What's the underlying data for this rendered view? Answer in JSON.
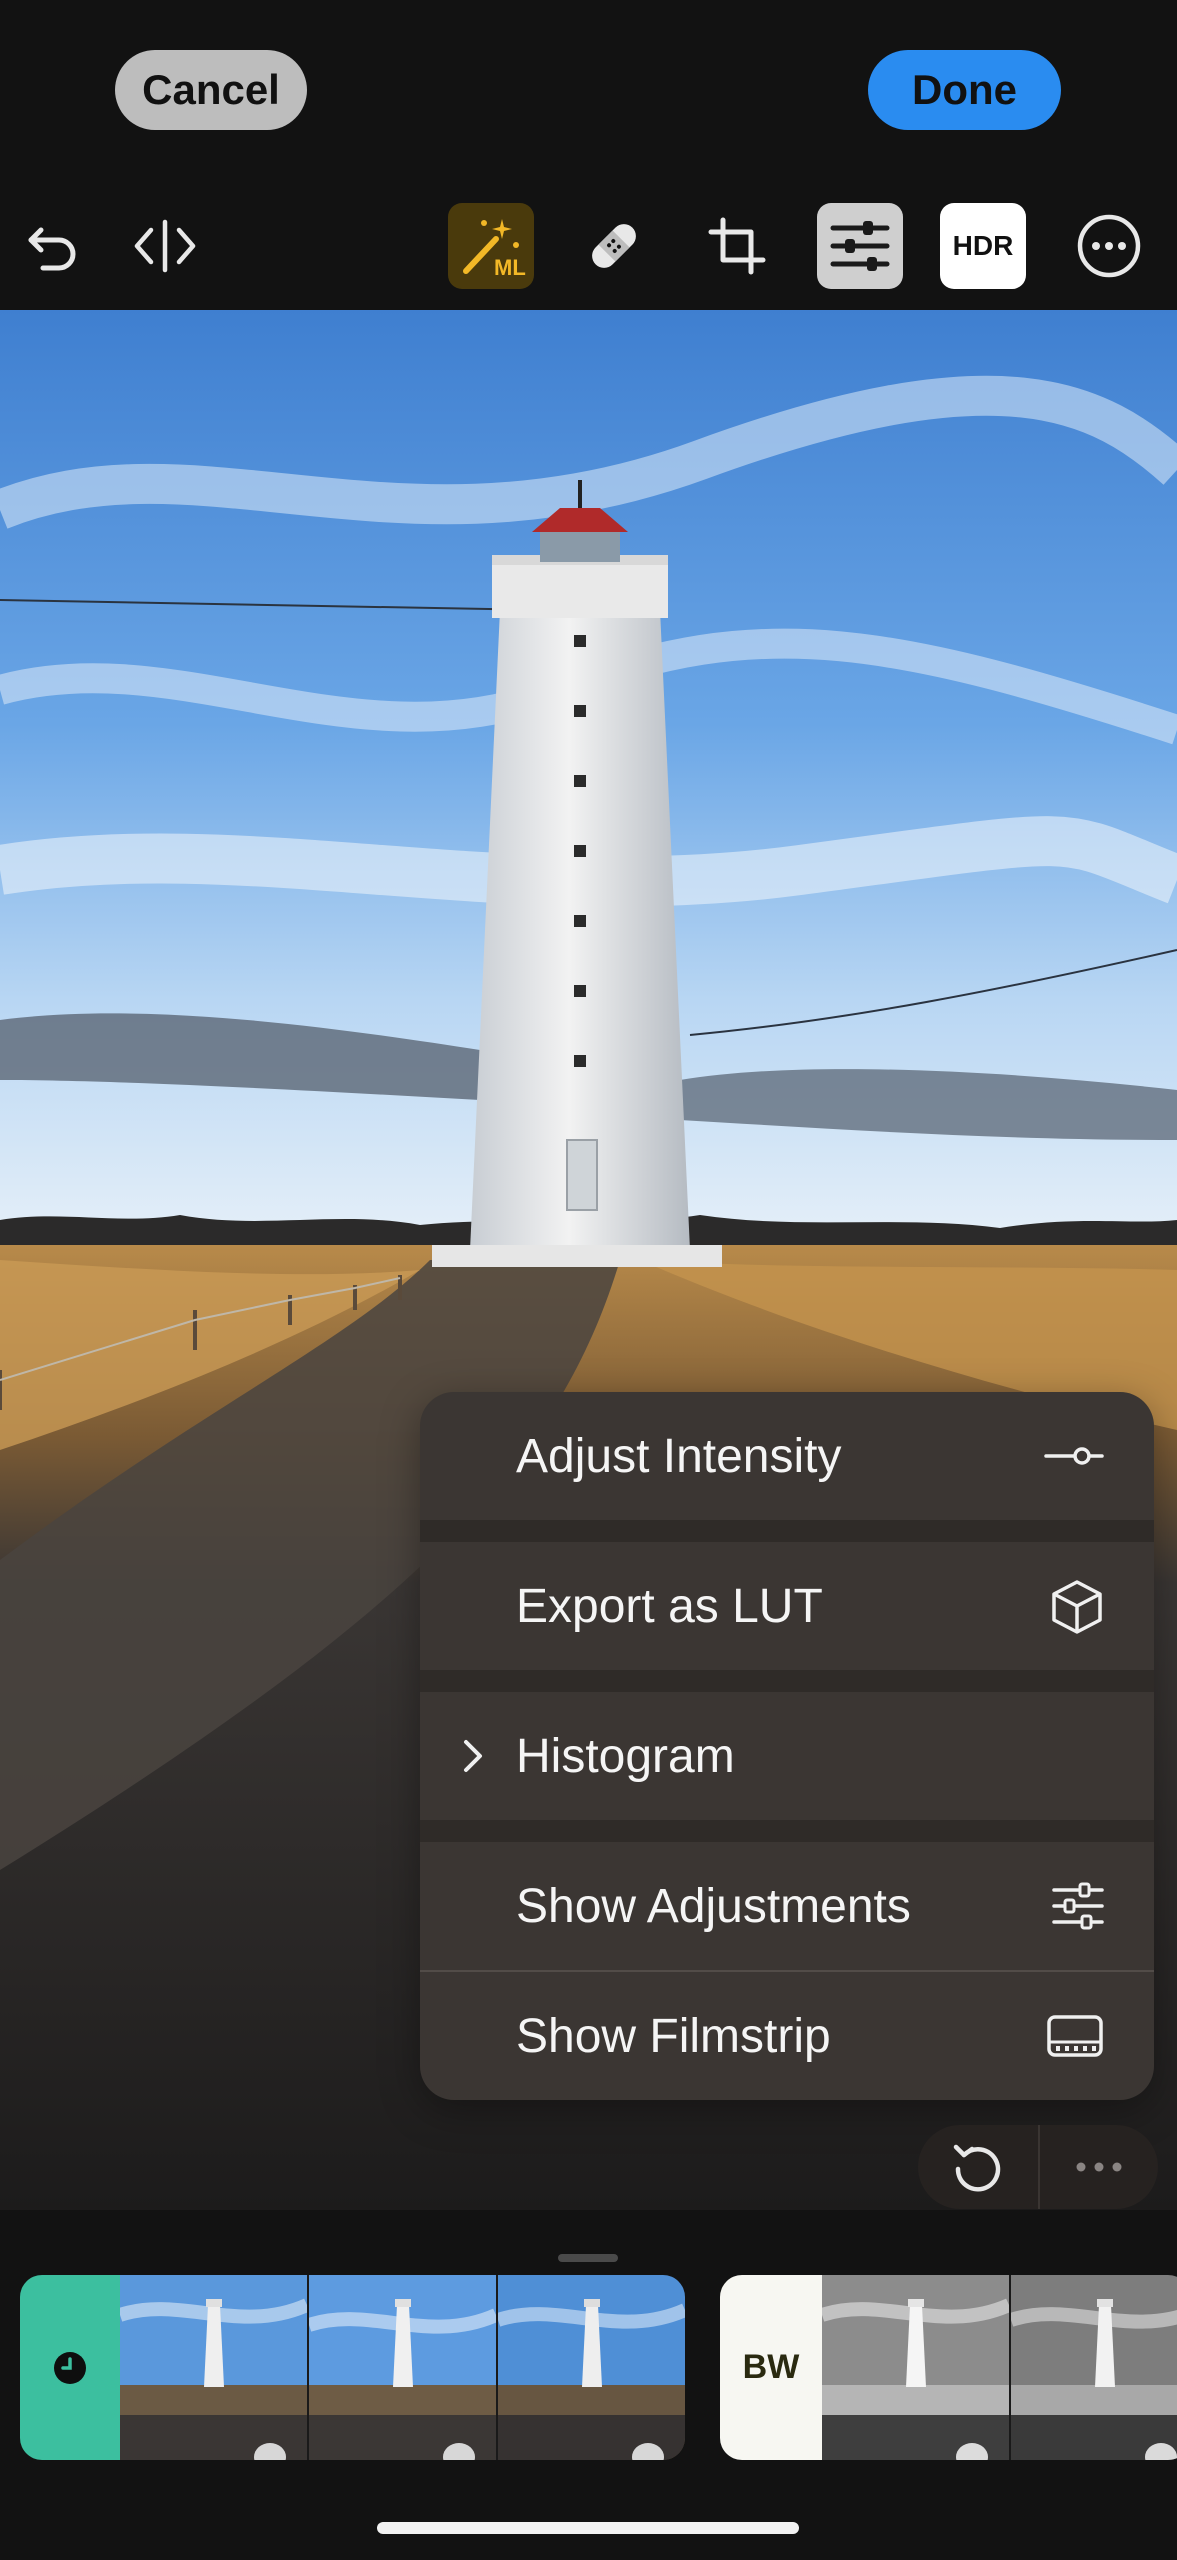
{
  "top_bar": {
    "cancel_label": "Cancel",
    "done_label": "Done",
    "hdr_label": "HDR",
    "ml_label": "ML"
  },
  "toolbar": {
    "icons": [
      "undo-icon",
      "compare-icon",
      "magic-wand-ml-icon",
      "bandage-icon",
      "crop-icon",
      "adjustments-icon",
      "hdr-icon",
      "more-icon"
    ]
  },
  "context_menu": {
    "items": [
      {
        "label": "Adjust Intensity",
        "icon": "slider-icon"
      },
      {
        "label": "Export as LUT",
        "icon": "cube-icon"
      },
      {
        "label": "Histogram",
        "icon": "chevron-right-icon"
      },
      {
        "label": "Show Adjustments",
        "icon": "adjustments-icon"
      },
      {
        "label": "Show Filmstrip",
        "icon": "filmstrip-icon"
      }
    ]
  },
  "filmstrip": {
    "bw_label": "BW"
  },
  "colors": {
    "done_button": "#2a8cf0",
    "cancel_button": "#bdbdbd",
    "ml_active": "#4a3a0c",
    "teal_group": "#3cbf9f",
    "menu_bg": "#3b3633"
  }
}
